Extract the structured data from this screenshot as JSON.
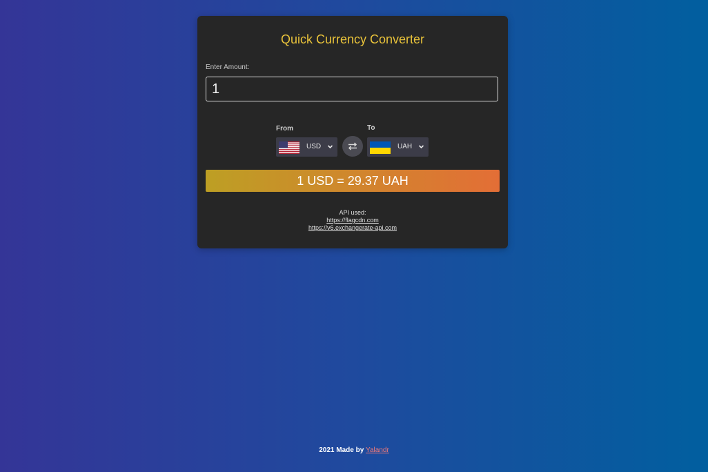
{
  "app": {
    "title": "Quick Currency Converter"
  },
  "amount": {
    "label": "Enter Amount:",
    "value": "1"
  },
  "from": {
    "label": "From",
    "currency": "USD",
    "flag_icon": "us-flag-icon"
  },
  "to": {
    "label": "To",
    "currency": "UAH",
    "flag_icon": "ua-flag-icon"
  },
  "swap": {
    "icon": "swap-arrows-icon"
  },
  "result": {
    "text": "1 USD = 29.37 UAH"
  },
  "api": {
    "label": "API used:",
    "links": [
      "https://flagcdn.com",
      "https://v6.exchangerate-api.com"
    ]
  },
  "footer": {
    "text": "2021 Made by",
    "author": "Yalandr"
  },
  "colors": {
    "title": "#e8c23a",
    "card": "#262626",
    "result_start": "#bd9f24",
    "result_end": "#e36e36",
    "footer_link": "#f07a78"
  }
}
